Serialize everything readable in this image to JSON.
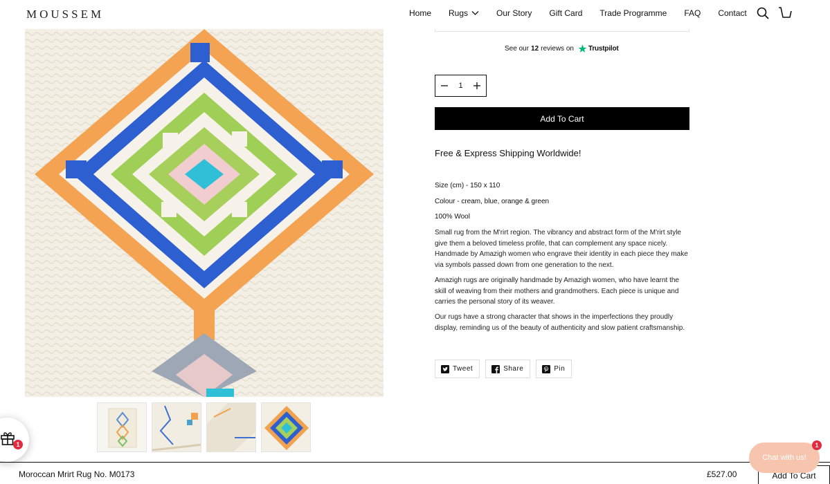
{
  "brand": {
    "logo_text": "MOUSSEM"
  },
  "nav": {
    "items": [
      "Home",
      "Rugs",
      "Our Story",
      "Gift Card",
      "Trade Programme",
      "FAQ",
      "Contact"
    ]
  },
  "icons": {
    "search": "search-icon",
    "cart": "cart-icon",
    "dropdown": "chevron-down-icon",
    "gift": "gift-icon",
    "minus": "minus-icon",
    "plus": "plus-icon",
    "twitter": "twitter-icon",
    "facebook": "facebook-icon",
    "pinterest": "pinterest-icon",
    "trustpilot_star": "trustpilot-star-icon"
  },
  "colors": {
    "accent": "#000000",
    "trustpilot_green": "#00b67a",
    "badge": "#e22b3f",
    "chat": "#f7c4ae"
  },
  "trustpilot": {
    "prefix": "See our",
    "count": "12",
    "suffix": "reviews on",
    "brand": "Trustpilot"
  },
  "quantity": {
    "value": "1"
  },
  "add_to_cart_label": "Add To Cart",
  "shipping_text": "Free & Express Shipping Worldwide!",
  "specs": {
    "size": "Size (cm) - 150 x 110",
    "colour": "Colour - cream, blue, orange & green",
    "material": "100% Wool"
  },
  "description": [
    "Small rug from the M'rirt region. The vibrancy and abstract form of the M'rirt style give them a beloved timeless profile, that can complement any space nicely. Handmade by Amazigh women who engrave their identity in each piece they make via symbols passed down from one generation to the next.",
    "Amazigh rugs are originally handmade by Amazigh women, who have learnt the skill of weaving from their mothers and grandmothers. Each piece is unique and carries the personal story of its weaver.",
    "Our rugs have a strong character that shows in the imperfections they proudly display, reminding us of the beauty of authenticity and slow patient craftsmanship."
  ],
  "share": {
    "tweet": "Tweet",
    "share": "Share",
    "pin": "Pin"
  },
  "gift_badge": "1",
  "chat": {
    "label": "Chat with us!",
    "badge": "1"
  },
  "sticky": {
    "product_name": "Moroccan Mrirt Rug No. M0173",
    "price": "£527.00",
    "button": "Add To Cart"
  }
}
